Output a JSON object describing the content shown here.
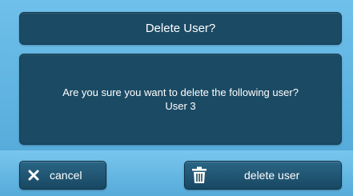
{
  "dialog": {
    "title": "Delete User?",
    "message": "Are you sure you want to delete the following user?",
    "user_name": "User 3"
  },
  "actions": {
    "cancel": {
      "label": "cancel",
      "icon": "close-icon"
    },
    "delete": {
      "label": "delete user",
      "icon": "trash-icon"
    }
  }
}
